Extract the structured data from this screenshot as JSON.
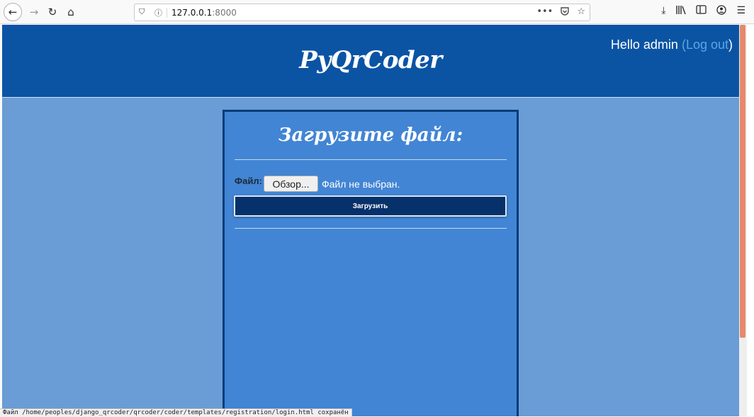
{
  "browser": {
    "url_host": "127.0.0.1",
    "url_port": ":8000",
    "page_actions_icon": "•••",
    "pocket_icon": "pocket-icon",
    "bookmark_icon": "star-icon"
  },
  "header": {
    "site_title": "PyQrCoder",
    "greeting": "Hello admin",
    "paren_open": "(",
    "logout_label": "Log out",
    "paren_close": ")"
  },
  "upload_form": {
    "title": "Загрузите файл:",
    "file_label": "Файл:",
    "browse_label": "Обзор...",
    "no_file_text": "Файл не выбран.",
    "submit_label": "Загрузить"
  },
  "status_bar": {
    "text": "Файл /home/peoples/django_qrcoder/qrcoder/coder/templates/registration/login.html сохранён"
  },
  "colors": {
    "header_bg": "#0b54a4",
    "page_bg": "#6a9cd5",
    "card_bg": "#4285d4",
    "card_border": "#083b7a",
    "submit_bg": "#07316a",
    "logout_link": "#5aa6e6"
  }
}
